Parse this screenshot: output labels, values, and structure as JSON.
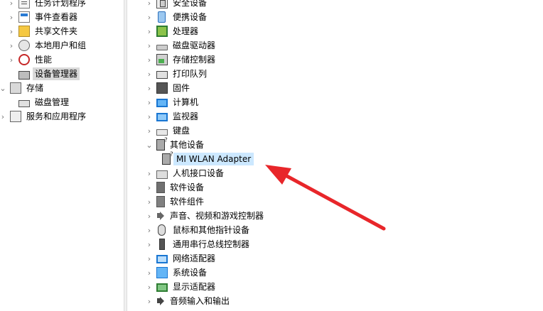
{
  "left_tree": [
    {
      "label": "任务计划程序",
      "icon": "task-scheduler-icon",
      "chevron": "›"
    },
    {
      "label": "事件查看器",
      "icon": "event-viewer-icon",
      "chevron": "›"
    },
    {
      "label": "共享文件夹",
      "icon": "shared-folders-icon",
      "chevron": "›"
    },
    {
      "label": "本地用户和组",
      "icon": "local-users-icon",
      "chevron": "›"
    },
    {
      "label": "性能",
      "icon": "performance-icon",
      "chevron": "›"
    },
    {
      "label": "设备管理器",
      "icon": "device-manager-icon",
      "chevron": ""
    },
    {
      "label": "存储",
      "icon": "storage-icon",
      "chevron": "⌄"
    },
    {
      "label": "磁盘管理",
      "icon": "disk-management-icon",
      "chevron": ""
    },
    {
      "label": "服务和应用程序",
      "icon": "services-apps-icon",
      "chevron": "›"
    }
  ],
  "device_tree": [
    {
      "label": "安全设备",
      "icon": "security-device-icon",
      "chevron": "›"
    },
    {
      "label": "便携设备",
      "icon": "portable-device-icon",
      "chevron": "›"
    },
    {
      "label": "处理器",
      "icon": "processor-icon",
      "chevron": "›"
    },
    {
      "label": "磁盘驱动器",
      "icon": "disk-drive-icon",
      "chevron": "›"
    },
    {
      "label": "存储控制器",
      "icon": "storage-controller-icon",
      "chevron": "›"
    },
    {
      "label": "打印队列",
      "icon": "printer-icon",
      "chevron": "›"
    },
    {
      "label": "固件",
      "icon": "firmware-icon",
      "chevron": "›"
    },
    {
      "label": "计算机",
      "icon": "computer-icon",
      "chevron": "›"
    },
    {
      "label": "监视器",
      "icon": "monitor-icon",
      "chevron": "›"
    },
    {
      "label": "键盘",
      "icon": "keyboard-icon",
      "chevron": "›"
    },
    {
      "label": "其他设备",
      "icon": "other-devices-icon",
      "chevron": "⌄"
    },
    {
      "label": "MI WLAN Adapter",
      "icon": "unknown-device-icon",
      "chevron": "",
      "selected": true
    },
    {
      "label": "人机接口设备",
      "icon": "hid-icon",
      "chevron": "›"
    },
    {
      "label": "软件设备",
      "icon": "software-device-icon",
      "chevron": "›"
    },
    {
      "label": "软件组件",
      "icon": "software-component-icon",
      "chevron": "›"
    },
    {
      "label": "声音、视频和游戏控制器",
      "icon": "sound-icon",
      "chevron": "›"
    },
    {
      "label": "鼠标和其他指针设备",
      "icon": "mouse-icon",
      "chevron": "›"
    },
    {
      "label": "通用串行总线控制器",
      "icon": "usb-icon",
      "chevron": "›"
    },
    {
      "label": "网络适配器",
      "icon": "network-adapter-icon",
      "chevron": "›"
    },
    {
      "label": "系统设备",
      "icon": "system-device-icon",
      "chevron": "›"
    },
    {
      "label": "显示适配器",
      "icon": "display-adapter-icon",
      "chevron": "›"
    },
    {
      "label": "音频输入和输出",
      "icon": "audio-io-icon",
      "chevron": "›"
    }
  ],
  "annotation": {
    "color": "#e8262a",
    "icon": "red-arrow-icon"
  }
}
